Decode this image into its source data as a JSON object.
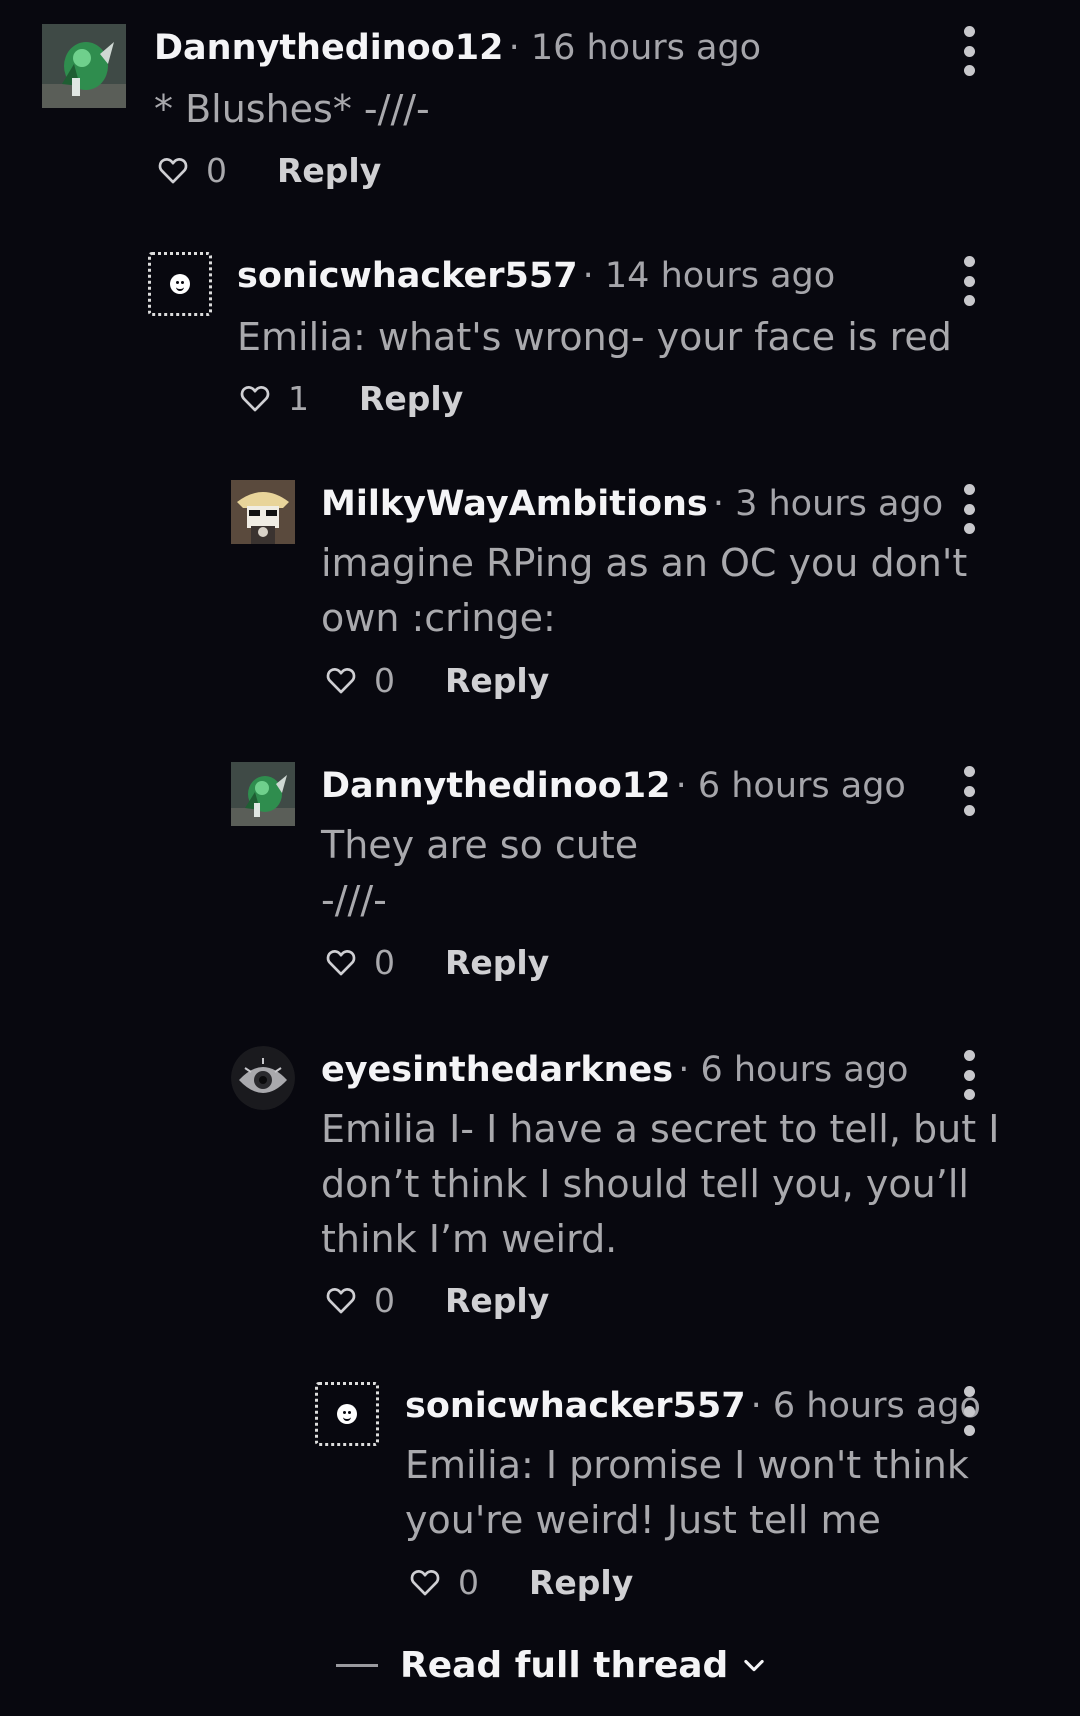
{
  "comments": [
    {
      "username": "Dannythedinoo12",
      "time": "· 16 hours ago",
      "text": "* Blushes* -///-",
      "likes": "0",
      "reply": "Reply"
    },
    {
      "username": "sonicwhacker557",
      "time": "· 14 hours ago",
      "text": "Emilia: what's wrong- your face is red",
      "likes": "1",
      "reply": "Reply"
    },
    {
      "username": "MilkyWayAmbitions",
      "time": "· 3 hours ago",
      "text": "imagine RPing as an OC you don't\nown :cringe:",
      "likes": "0",
      "reply": "Reply"
    },
    {
      "username": "Dannythedinoo12",
      "time": "· 6 hours ago",
      "text": "They are so cute\n-///-",
      "likes": "0",
      "reply": "Reply"
    },
    {
      "username": "eyesinthedarknes",
      "time": "· 6 hours ago",
      "text": "Emilia I- I have a secret to tell, but I\ndon’t think I should tell you, you’ll\nthink I’m weird.",
      "likes": "0",
      "reply": "Reply"
    },
    {
      "username": "sonicwhacker557",
      "time": "· 6 hours ago",
      "text": "Emilia: I promise I won't think\nyou're weird! Just tell me",
      "likes": "0",
      "reply": "Reply"
    }
  ],
  "footer": {
    "read_full_thread": "Read full thread"
  },
  "icons": {
    "heart": "heart-icon",
    "more": "more-vertical-icon",
    "chevron": "chevron-down-icon"
  }
}
